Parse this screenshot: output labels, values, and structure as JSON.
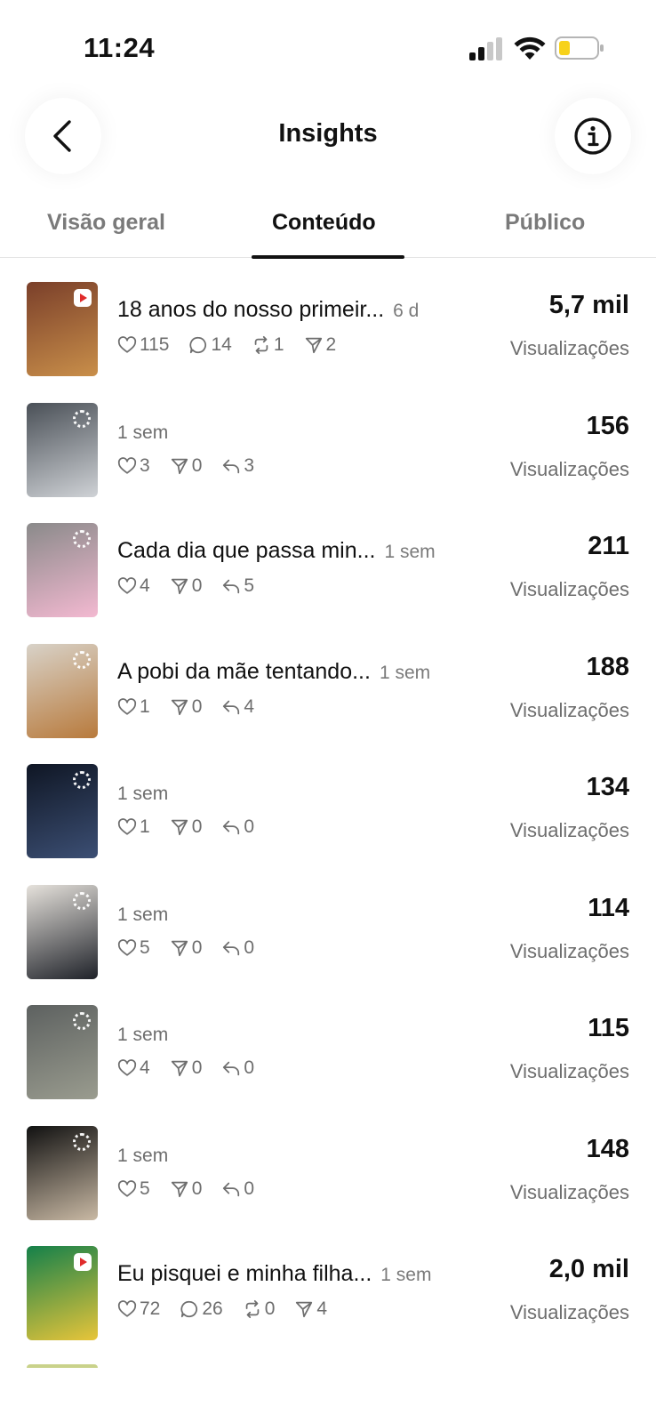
{
  "status_bar": {
    "time": "11:24",
    "battery_color": "#f7d21b"
  },
  "header": {
    "title": "Insights",
    "back_icon": "chevron-left-icon",
    "info_icon": "info-circle-icon"
  },
  "tabs": [
    {
      "label": "Visão geral",
      "active": false
    },
    {
      "label": "Conteúdo",
      "active": true
    },
    {
      "label": "Público",
      "active": false
    }
  ],
  "items": [
    {
      "caption": "18 anos do nosso primeir...",
      "age": "6 d",
      "thumb_badge": "video",
      "thumb_colors": [
        "#7a3f2a",
        "#c98f4a"
      ],
      "stats": [
        {
          "icon": "heart-icon",
          "value": "115"
        },
        {
          "icon": "comment-icon",
          "value": "14"
        },
        {
          "icon": "repost-icon",
          "value": "1"
        },
        {
          "icon": "send-icon",
          "value": "2"
        }
      ],
      "views": "5,7 mil",
      "views_label": "Visualizações"
    },
    {
      "caption": "",
      "age": "1 sem",
      "thumb_badge": "story",
      "thumb_colors": [
        "#4a5057",
        "#cfd2d6"
      ],
      "stats": [
        {
          "icon": "heart-icon",
          "value": "3"
        },
        {
          "icon": "send-icon",
          "value": "0"
        },
        {
          "icon": "reply-icon",
          "value": "3"
        }
      ],
      "views": "156",
      "views_label": "Visualizações"
    },
    {
      "caption": "Cada dia que passa min...",
      "age": "1 sem",
      "thumb_badge": "story",
      "thumb_colors": [
        "#8a8a8a",
        "#f3b9d1"
      ],
      "stats": [
        {
          "icon": "heart-icon",
          "value": "4"
        },
        {
          "icon": "send-icon",
          "value": "0"
        },
        {
          "icon": "reply-icon",
          "value": "5"
        }
      ],
      "views": "211",
      "views_label": "Visualizações"
    },
    {
      "caption": "A pobi da mãe tentando...",
      "age": "1 sem",
      "thumb_badge": "story",
      "thumb_colors": [
        "#d8d2c8",
        "#b87a3c"
      ],
      "stats": [
        {
          "icon": "heart-icon",
          "value": "1"
        },
        {
          "icon": "send-icon",
          "value": "0"
        },
        {
          "icon": "reply-icon",
          "value": "4"
        }
      ],
      "views": "188",
      "views_label": "Visualizações"
    },
    {
      "caption": "",
      "age": "1 sem",
      "thumb_badge": "story",
      "thumb_colors": [
        "#0f1624",
        "#3c4f74"
      ],
      "stats": [
        {
          "icon": "heart-icon",
          "value": "1"
        },
        {
          "icon": "send-icon",
          "value": "0"
        },
        {
          "icon": "reply-icon",
          "value": "0"
        }
      ],
      "views": "134",
      "views_label": "Visualizações"
    },
    {
      "caption": "",
      "age": "1 sem",
      "thumb_badge": "story",
      "thumb_colors": [
        "#e6e2dc",
        "#1f2229"
      ],
      "stats": [
        {
          "icon": "heart-icon",
          "value": "5"
        },
        {
          "icon": "send-icon",
          "value": "0"
        },
        {
          "icon": "reply-icon",
          "value": "0"
        }
      ],
      "views": "114",
      "views_label": "Visualizações"
    },
    {
      "caption": "",
      "age": "1 sem",
      "thumb_badge": "story",
      "thumb_colors": [
        "#5d6160",
        "#9a9c8f"
      ],
      "stats": [
        {
          "icon": "heart-icon",
          "value": "4"
        },
        {
          "icon": "send-icon",
          "value": "0"
        },
        {
          "icon": "reply-icon",
          "value": "0"
        }
      ],
      "views": "115",
      "views_label": "Visualizações"
    },
    {
      "caption": "",
      "age": "1 sem",
      "thumb_badge": "story",
      "thumb_colors": [
        "#111111",
        "#c9b9a4"
      ],
      "stats": [
        {
          "icon": "heart-icon",
          "value": "5"
        },
        {
          "icon": "send-icon",
          "value": "0"
        },
        {
          "icon": "reply-icon",
          "value": "0"
        }
      ],
      "views": "148",
      "views_label": "Visualizações"
    },
    {
      "caption": "Eu pisquei e minha filha...",
      "age": "1 sem",
      "thumb_badge": "video",
      "thumb_colors": [
        "#14804a",
        "#e8c53a"
      ],
      "stats": [
        {
          "icon": "heart-icon",
          "value": "72"
        },
        {
          "icon": "comment-icon",
          "value": "26"
        },
        {
          "icon": "repost-icon",
          "value": "0"
        },
        {
          "icon": "send-icon",
          "value": "4"
        }
      ],
      "views": "2,0 mil",
      "views_label": "Visualizações"
    }
  ]
}
